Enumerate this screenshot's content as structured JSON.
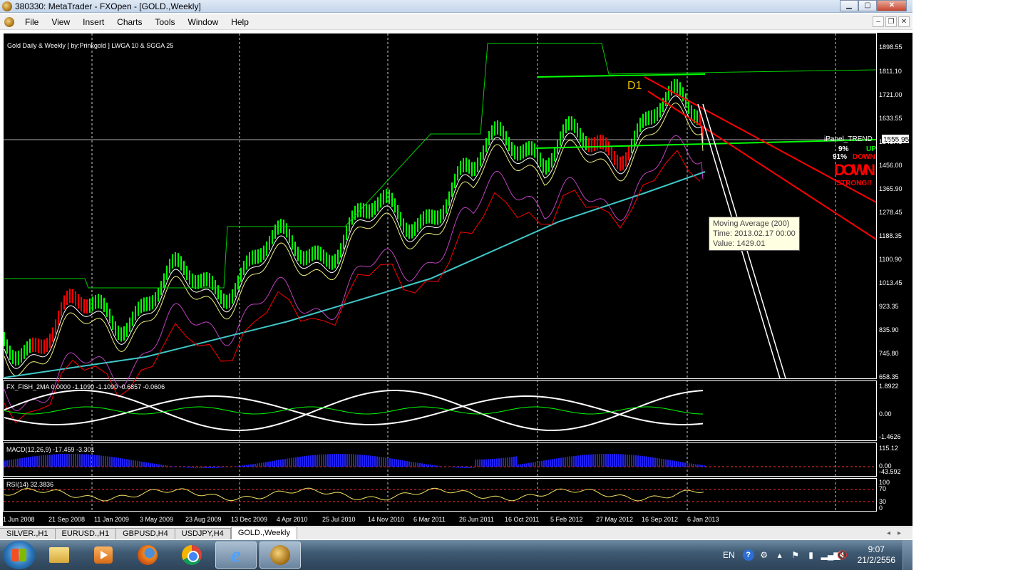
{
  "window": {
    "title": "380330: MetaTrader - FXOpen - [GOLD.,Weekly]",
    "buttons": {
      "minimize": "▁",
      "maximize": "▢",
      "close": "✕"
    }
  },
  "menu": {
    "items": [
      "File",
      "View",
      "Insert",
      "Charts",
      "Tools",
      "Window",
      "Help"
    ],
    "mdi_buttons": {
      "minimize": "–",
      "restore": "❐",
      "close": "✕"
    }
  },
  "chart": {
    "title": "Gold Daily & Weekly [ by:Prinkgold ]  LWGA 10  &  SGGA 25",
    "price_ticks": [
      "1898.55",
      "1811.10",
      "1721.00",
      "1633.55",
      "1543.45",
      "1456.00",
      "1365.90",
      "1278.45",
      "1188.35",
      "1100.90",
      "1013.45",
      "923.35",
      "835.90",
      "745.80",
      "658.35"
    ],
    "current_price": "1555.95",
    "annotation": "D1",
    "ipanel": {
      "title": "iPanel_TREND",
      "up_pct": "9%",
      "up_label": "UP",
      "down_pct": "91%",
      "down_label": "DOWN",
      "big_label": "DOWN",
      "strength": "!STRONG!!"
    },
    "tooltip": {
      "line1": "Moving Average (200)",
      "line2": "Time: 2013.02.17 00:00",
      "line3": "Value: 1429.01"
    },
    "x_ticks": [
      "1 Jun 2008",
      "21 Sep 2008",
      "11 Jan 2009",
      "3 May 2009",
      "23 Aug 2009",
      "13 Dec 2009",
      "4 Apr 2010",
      "25 Jul 2010",
      "14 Nov 2010",
      "6 Mar 2011",
      "26 Jun 2011",
      "16 Oct 2011",
      "5 Feb 2012",
      "27 May 2012",
      "16 Sep 2012",
      "6 Jan 2013"
    ]
  },
  "indicators": {
    "fish": {
      "label": "FX_FISH_2MA 0.0000 -1.1090 -1.1090 -0.6857 -0.0606",
      "ticks": [
        "1.8922",
        "0.00",
        "-1.4626"
      ]
    },
    "macd": {
      "label": "MACD(12,26,9) -17.459 -3.301",
      "ticks": [
        "115.12",
        "0.00",
        "-43.592"
      ]
    },
    "rsi": {
      "label": "RSI(14) 32.3836",
      "ticks": [
        "100",
        "70",
        "30",
        "0"
      ]
    }
  },
  "colors": {
    "bull_candle": "#00ff00",
    "bear_candle": "#ff0000",
    "ma200": "#40c8c8",
    "ma_magenta": "#c040c0",
    "channel": "#ff0000",
    "price_line": "#ffffff",
    "background": "#000000"
  },
  "tabs": [
    "SILVER.,H1",
    "EURUSD.,H1",
    "GBPUSD,H4",
    "USDJPY,H4",
    "GOLD.,Weekly"
  ],
  "active_tab": "GOLD.,Weekly",
  "tab_scroll": "◂▸",
  "taskbar": {
    "apps": [
      "folder-icon",
      "media-player-icon",
      "firefox-icon",
      "chrome-icon",
      "internet-explorer-icon",
      "metatrader-icon"
    ],
    "ie_glyph": "e",
    "language": "EN",
    "help": "?",
    "time": "9:07",
    "date": "21/2/2556"
  }
}
